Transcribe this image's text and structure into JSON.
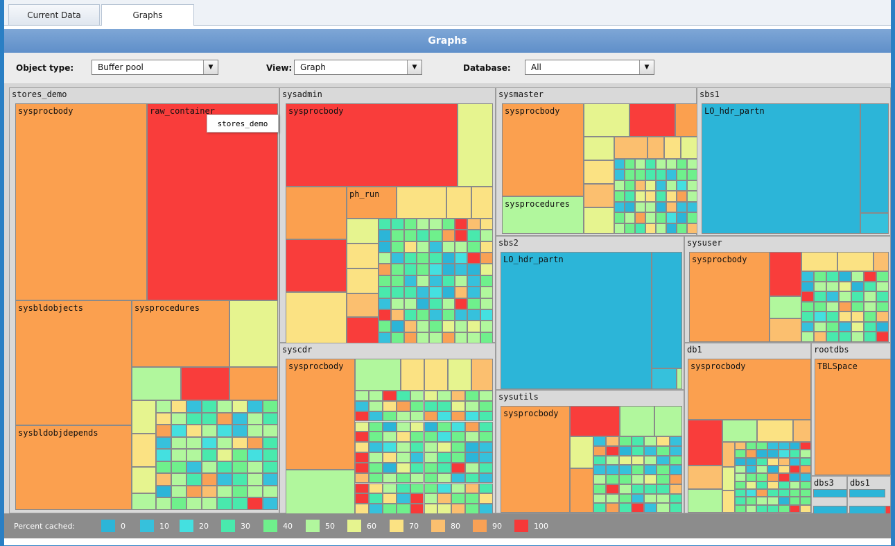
{
  "tabs": [
    {
      "label": "Current Data"
    },
    {
      "label": "Graphs",
      "active": true
    }
  ],
  "panel_title": "Graphs",
  "filters": {
    "object_type": {
      "label": "Object type:",
      "value": "Buffer pool"
    },
    "view": {
      "label": "View:",
      "value": "Graph"
    },
    "database": {
      "label": "Database:",
      "value": "All"
    }
  },
  "groups": {
    "stores_demo": "stores_demo",
    "sysadmin": "sysadmin",
    "sysmaster": "sysmaster",
    "sbs1": "sbs1",
    "sbs2": "sbs2",
    "sysuser": "sysuser",
    "syscdr": "syscdr",
    "sysutils": "sysutils",
    "db1": "db1",
    "rootdbs": "rootdbs",
    "dbs3": "dbs3",
    "dbs1": "dbs1"
  },
  "cell_labels": {
    "stores_demo": [
      "sysprocbody",
      "raw_container",
      "sysbldobjects",
      "sysprocedures",
      "sysbldobjdepends"
    ],
    "sysadmin": [
      "sysprocbody",
      "ph_run"
    ],
    "sysmaster": [
      "sysprocbody",
      "sysprocedures"
    ],
    "sbs1": [
      "LO_hdr_partn"
    ],
    "sbs2": [
      "LO_hdr_partn"
    ],
    "sysuser": [
      "sysprocbody"
    ],
    "syscdr": [
      "sysprocbody"
    ],
    "sysutils": [
      "sysprocbody"
    ],
    "db1": [
      "sysprocbody"
    ],
    "rootdbs": [
      "TBLSpace"
    ]
  },
  "tooltip": "stores_demo",
  "legend": {
    "title": "Percent cached:",
    "items": [
      {
        "value": "0",
        "color": "#2cb5d8"
      },
      {
        "value": "10",
        "color": "#36c1dc"
      },
      {
        "value": "20",
        "color": "#44e0e0"
      },
      {
        "value": "30",
        "color": "#49e9ad"
      },
      {
        "value": "40",
        "color": "#6ff08c"
      },
      {
        "value": "50",
        "color": "#b1f79d"
      },
      {
        "value": "60",
        "color": "#e6f48f"
      },
      {
        "value": "70",
        "color": "#fbe283"
      },
      {
        "value": "80",
        "color": "#fbbf6f"
      },
      {
        "value": "90",
        "color": "#f9a155"
      },
      {
        "value": "100",
        "color": "#f73939"
      }
    ]
  }
}
